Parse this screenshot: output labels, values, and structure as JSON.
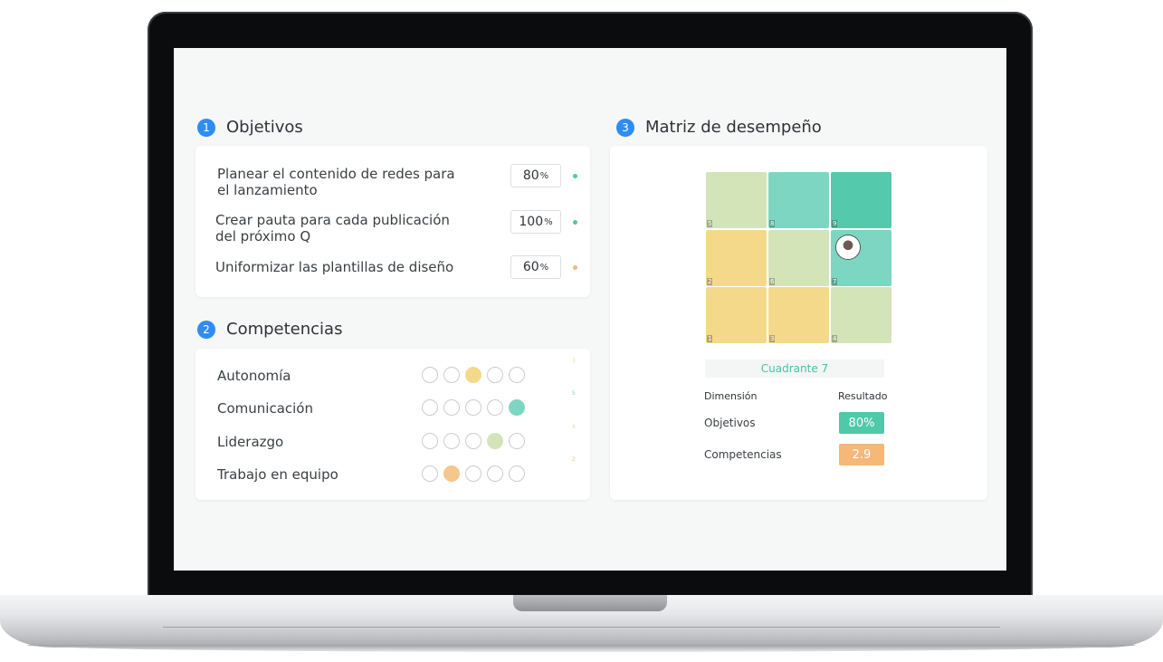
{
  "colors": {
    "accent_blue": "#2f8cf5",
    "teal": "#4ec9aa",
    "orange": "#f5b877",
    "yellow": "#f5d98a",
    "light_green": "#d3e4b9",
    "mid_teal": "#7dd6c1",
    "dark_teal": "#55c9ac"
  },
  "objetivos": {
    "number": "1",
    "title": "Objetivos",
    "items": [
      {
        "text": "Planear el contenido de redes para el lanzamiento",
        "value": "80",
        "unit": "%",
        "status_color": "#4ec9aa"
      },
      {
        "text": "Crear pauta para cada publicación del próximo Q",
        "value": "100",
        "unit": "%",
        "status_color": "#4ec9aa"
      },
      {
        "text": "Uniformizar las plantillas de diseño",
        "value": "60",
        "unit": "%",
        "status_color": "#f5b877"
      }
    ]
  },
  "competencias": {
    "number": "2",
    "title": "Competencias",
    "items": [
      {
        "label": "Autonomía",
        "level": 3,
        "color": "#f5d98a",
        "score": "3"
      },
      {
        "label": "Comunicación",
        "level": 5,
        "color": "#7dd6c1",
        "score": "5"
      },
      {
        "label": "Liderazgo",
        "level": 4,
        "color": "#d3e4b9",
        "score": "4"
      },
      {
        "label": "Trabajo en equipo",
        "level": 2,
        "color": "#f5c68d",
        "score": "2"
      }
    ]
  },
  "matriz": {
    "number": "3",
    "title": "Matriz de desempeño",
    "cells": [
      {
        "num": "5",
        "color": "#d3e4b9"
      },
      {
        "num": "8",
        "color": "#7dd6c1"
      },
      {
        "num": "9",
        "color": "#55c9ac"
      },
      {
        "num": "2",
        "color": "#f5d98a"
      },
      {
        "num": "6",
        "color": "#d3e4b9"
      },
      {
        "num": "7",
        "color": "#7dd6c1"
      },
      {
        "num": "1",
        "color": "#f5d98a"
      },
      {
        "num": "3",
        "color": "#f5d98a"
      },
      {
        "num": "4",
        "color": "#d3e4b9"
      }
    ],
    "active_cell": "7",
    "quadrant_label": "Cuadrante 7",
    "table": {
      "col_dimension": "Dimensión",
      "col_result": "Resultado",
      "rows": [
        {
          "label": "Objetivos",
          "value": "80%",
          "color": "#4ec9aa"
        },
        {
          "label": "Competencias",
          "value": "2.9",
          "color": "#f5b877"
        }
      ]
    }
  }
}
